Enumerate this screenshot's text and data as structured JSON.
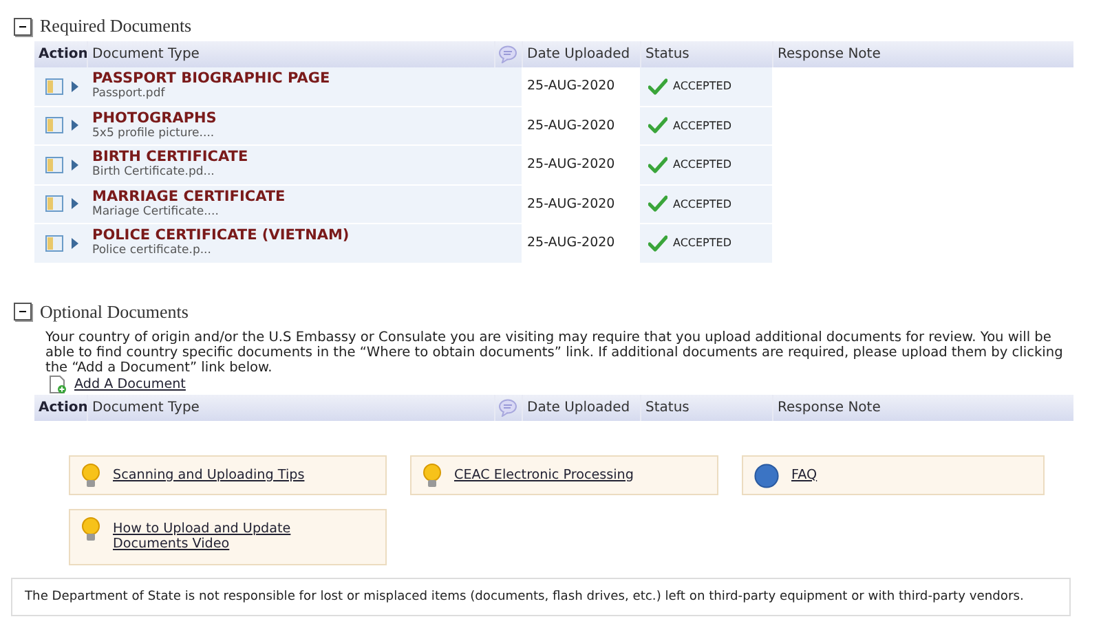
{
  "required": {
    "title": "Required Documents",
    "expanded": true,
    "columns": [
      "Action",
      "Document Type",
      "Date Uploaded",
      "Status",
      "Response Note"
    ],
    "rows": [
      {
        "type": "PASSPORT BIOGRAPHIC PAGE",
        "file": "Passport.pdf",
        "date": "25-AUG-2020",
        "status": "ACCEPTED"
      },
      {
        "type": "PHOTOGRAPHS",
        "file": "5x5 profile picture....",
        "date": "25-AUG-2020",
        "status": "ACCEPTED"
      },
      {
        "type": "BIRTH CERTIFICATE",
        "file": "Birth Certificate.pd...",
        "date": "25-AUG-2020",
        "status": "ACCEPTED"
      },
      {
        "type": "MARRIAGE CERTIFICATE",
        "file": "Mariage Certificate....",
        "date": "25-AUG-2020",
        "status": "ACCEPTED"
      },
      {
        "type": "POLICE CERTIFICATE (VIETNAM)",
        "file": "Police certificate.p...",
        "date": "25-AUG-2020",
        "status": "ACCEPTED"
      }
    ]
  },
  "optional": {
    "title": "Optional Documents",
    "expanded": true,
    "description": "Your country of origin and/or the U.S Embassy or Consulate you are visiting may require that you upload additional documents for review. You will be able to find country specific documents in the “Where to obtain documents” link. If additional documents are required, please upload them by clicking the “Add a Document” link below.",
    "add_link": "Add A Document",
    "columns": [
      "Action",
      "Document Type",
      "Date Uploaded",
      "Status",
      "Response Note"
    ]
  },
  "help_links": [
    {
      "kind": "tip",
      "label": "Scanning and Uploading Tips"
    },
    {
      "kind": "tip",
      "label": "CEAC Electronic Processing"
    },
    {
      "kind": "faq",
      "label": "FAQ"
    },
    {
      "kind": "tip",
      "label": "How to Upload and Update Documents Video"
    }
  ],
  "disclaimer": "The Department of State is not responsible for lost or misplaced items (documents, flash drives, etc.) left on third-party equipment or with third-party vendors."
}
